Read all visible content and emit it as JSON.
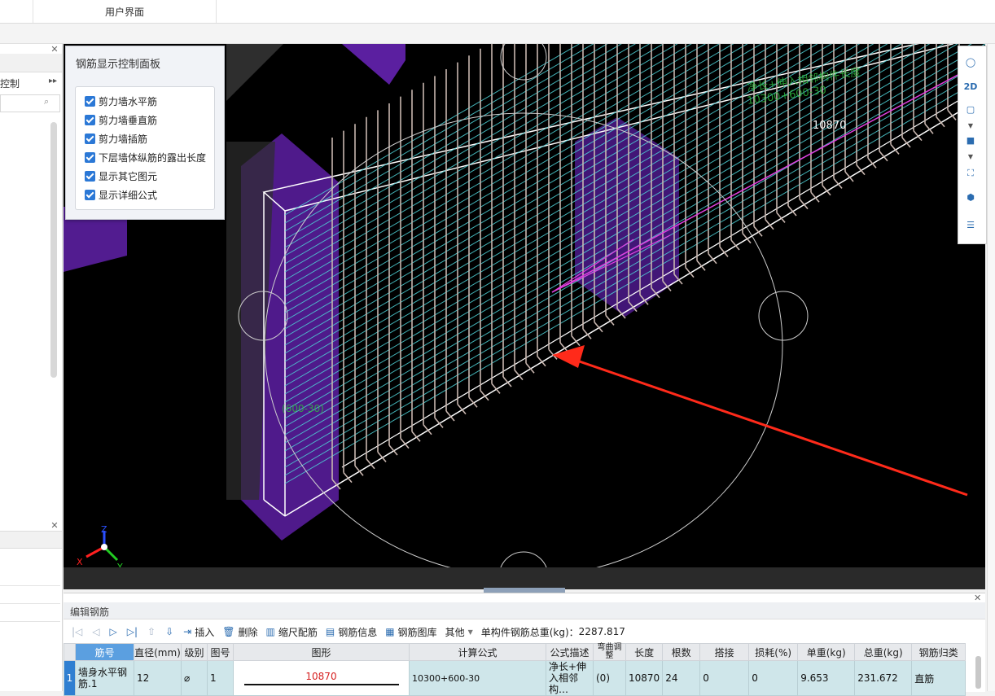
{
  "top_tab": "用户界面",
  "left_panel": {
    "item_label": "控制",
    "more_icon": "double-chevron-right-icon",
    "search_icon": "search-icon",
    "close_icon": "close-icon"
  },
  "control_panel": {
    "title": "钢筋显示控制面板",
    "options": [
      {
        "label": "剪力墙水平筋",
        "checked": true
      },
      {
        "label": "剪力墙垂直筋",
        "checked": true
      },
      {
        "label": "剪力墙插筋",
        "checked": true
      },
      {
        "label": "下层墙体纵筋的露出长度",
        "checked": true
      },
      {
        "label": "显示其它图元",
        "checked": true
      },
      {
        "label": "显示详细公式",
        "checked": true
      }
    ]
  },
  "viewport": {
    "dimension_label": "10870",
    "side_label": "(600-30)",
    "axes": {
      "x": "X",
      "y": "Y",
      "z": "Z"
    }
  },
  "right_toolbar": [
    "globe-icon",
    "2d-view-icon",
    "cube-outline-icon",
    "chevron-down-icon",
    "cube-solid-icon",
    "chevron-down-icon",
    "fullscreen-icon",
    "model-view-icon",
    "list-eye-icon"
  ],
  "right_toolbar_2d": "2D",
  "editor": {
    "title": "编辑钢筋",
    "toolbar": {
      "insert": "插入",
      "delete": "删除",
      "scale": "缩尺配筋",
      "info": "钢筋信息",
      "library": "钢筋图库",
      "other": "其他",
      "total_label": "单构件钢筋总重(kg)：",
      "total_value": "2287.817"
    },
    "columns": [
      "筋号",
      "直径(mm)",
      "级别",
      "图号",
      "图形",
      "计算公式",
      "公式描述",
      "弯曲调整",
      "长度",
      "根数",
      "搭接",
      "损耗(%)",
      "单重(kg)",
      "总重(kg)",
      "钢筋归类"
    ],
    "rows": [
      {
        "num": "1",
        "name": "墙身水平钢筋.1",
        "diameter": "12",
        "grade": "⌀",
        "fig": "1",
        "shape_value": "10870",
        "formula": "10300+600-30",
        "desc": "净长+伸入相邻构…",
        "bend": "(0)",
        "length": "10870",
        "count": "24",
        "lap": "0",
        "loss": "0",
        "unit_w": "9.653",
        "total_w": "231.672",
        "category": "直筋"
      }
    ]
  }
}
